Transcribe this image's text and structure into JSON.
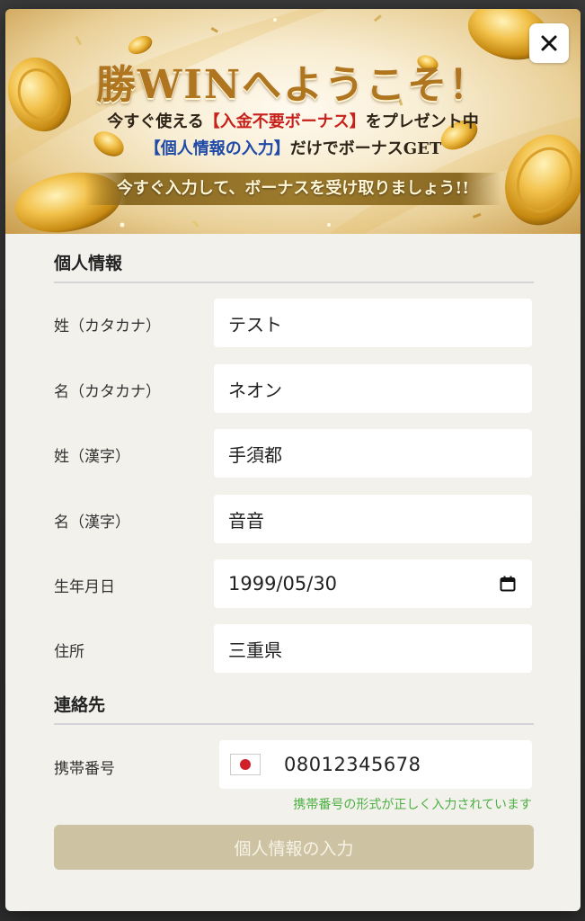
{
  "banner": {
    "title": "勝WINへようこそ！",
    "line1_pre": "今すぐ使える",
    "line1_highlight": "【入金不要ボーナス】",
    "line1_post": "をプレゼント中",
    "line2_highlight": "【個人情報の入力】",
    "line2_post": "だけでボーナスGET",
    "ribbon": "今すぐ入力して、ボーナスを受け取りましょう!!"
  },
  "close_icon": "close-icon",
  "personal_section": {
    "title": "個人情報",
    "fields": [
      {
        "label": "姓（カタカナ）",
        "value": "テスト"
      },
      {
        "label": "名（カタカナ）",
        "value": "ネオン"
      },
      {
        "label": "姓（漢字）",
        "value": "手須都"
      },
      {
        "label": "名（漢字）",
        "value": "音音"
      },
      {
        "label": "生年月日",
        "value": "1999/05/30"
      },
      {
        "label": "住所",
        "value": "三重県"
      }
    ]
  },
  "contact_section": {
    "title": "連絡先",
    "phone_label": "携帯番号",
    "phone_value": "08012345678",
    "country_flag": "japan-flag-icon",
    "validation_message": "携帯番号の形式が正しく入力されています"
  },
  "submit_label": "個人情報の入力",
  "colors": {
    "modal_bg": "#f3f1ec",
    "submit_bg": "#cdc3a2",
    "validation_green": "#4cb043",
    "highlight_red": "#c8201a",
    "highlight_blue": "#1f4aa8",
    "gold": "#b0761f"
  }
}
